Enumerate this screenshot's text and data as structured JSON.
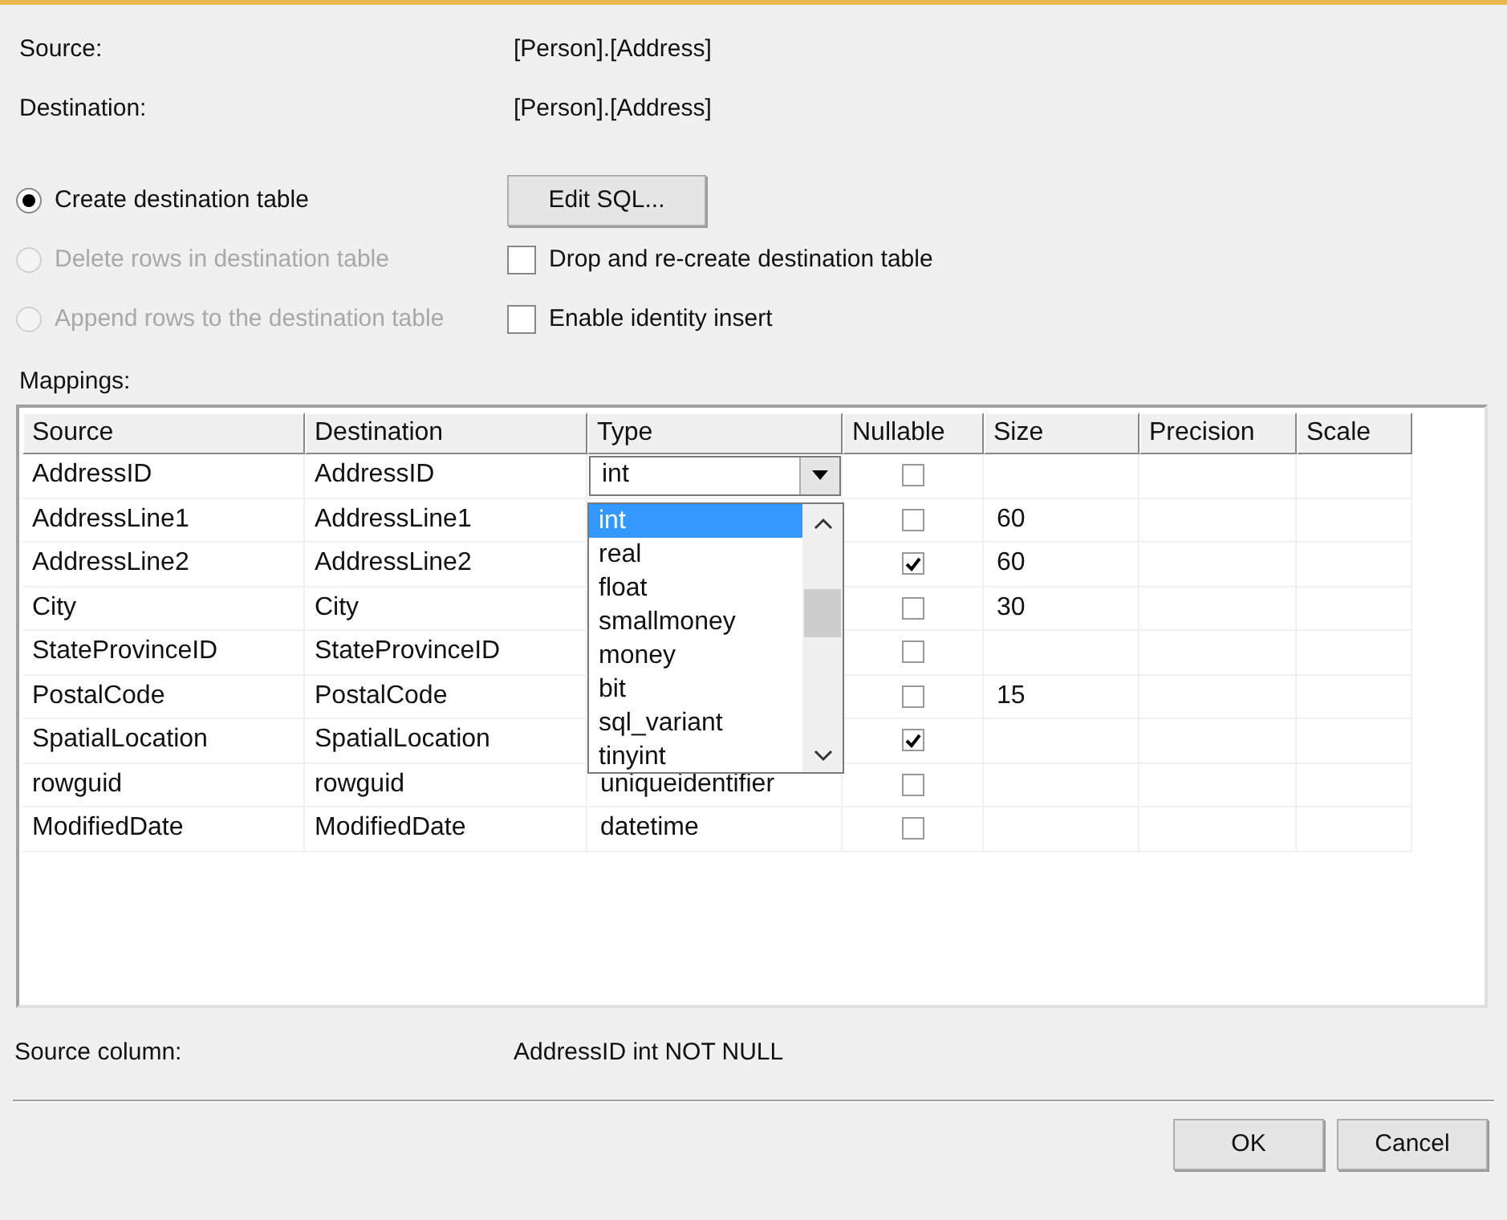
{
  "source": {
    "label": "Source:",
    "value": "[Person].[Address]"
  },
  "destination": {
    "label": "Destination:",
    "value": "[Person].[Address]"
  },
  "options": [
    {
      "label": "Create destination table",
      "selected": true,
      "disabled": false
    },
    {
      "label": "Delete rows in destination table",
      "selected": false,
      "disabled": true
    },
    {
      "label": "Append rows to the destination table",
      "selected": false,
      "disabled": true
    }
  ],
  "edit_sql_button": "Edit SQL...",
  "checkboxes": [
    {
      "label": "Drop and re-create destination table",
      "checked": false
    },
    {
      "label": "Enable identity insert",
      "checked": false
    }
  ],
  "mappings": {
    "label": "Mappings:",
    "columns": [
      "Source",
      "Destination",
      "Type",
      "Nullable",
      "Size",
      "Precision",
      "Scale"
    ],
    "rows": [
      {
        "source": "AddressID",
        "destination": "AddressID",
        "type": "int",
        "editing": true,
        "nullable": false,
        "size": ""
      },
      {
        "source": "AddressLine1",
        "destination": "AddressLine1",
        "nullable": false,
        "size": "60"
      },
      {
        "source": "AddressLine2",
        "destination": "AddressLine2",
        "nullable": true,
        "size": "60"
      },
      {
        "source": "City",
        "destination": "City",
        "nullable": false,
        "size": "30"
      },
      {
        "source": "StateProvinceID",
        "destination": "StateProvinceID",
        "nullable": false,
        "size": ""
      },
      {
        "source": "PostalCode",
        "destination": "PostalCode",
        "nullable": false,
        "size": "15"
      },
      {
        "source": "SpatialLocation",
        "destination": "SpatialLocation",
        "nullable": true,
        "size": ""
      },
      {
        "source": "rowguid",
        "destination": "rowguid",
        "type": "uniqueidentifier",
        "nullable": false,
        "size": ""
      },
      {
        "source": "ModifiedDate",
        "destination": "ModifiedDate",
        "type": "datetime",
        "nullable": false,
        "size": ""
      }
    ],
    "type_dropdown": [
      {
        "label": "int",
        "selected": true
      },
      {
        "label": "real",
        "selected": false
      },
      {
        "label": "float",
        "selected": false
      },
      {
        "label": "smallmoney",
        "selected": false
      },
      {
        "label": "money",
        "selected": false
      },
      {
        "label": "bit",
        "selected": false
      },
      {
        "label": "sql_variant",
        "selected": false
      },
      {
        "label": "tinyint",
        "selected": false
      }
    ]
  },
  "source_column": {
    "label": "Source column:",
    "value": "AddressID int NOT NULL"
  },
  "buttons": [
    "OK",
    "Cancel"
  ]
}
